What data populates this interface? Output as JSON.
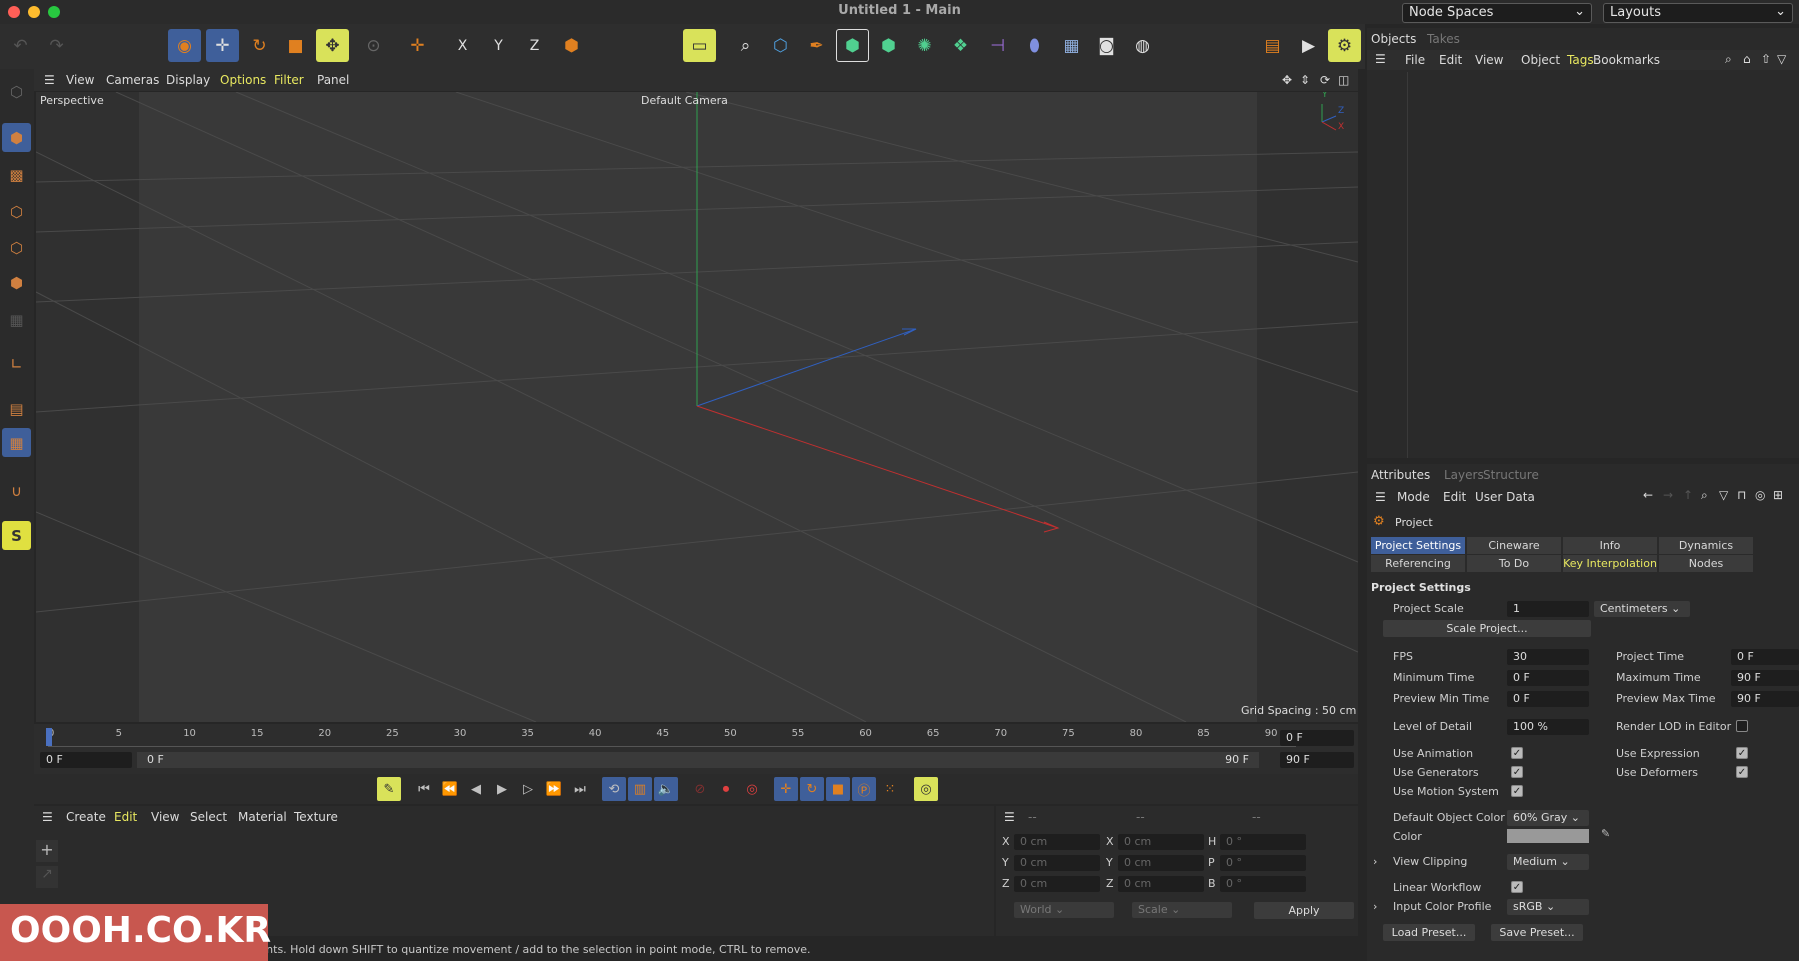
{
  "window": {
    "title": "Untitled 1 - Main",
    "node_spaces": "Node Spaces",
    "layouts": "Layouts"
  },
  "viewport_menu": [
    "View",
    "Cameras",
    "Display",
    "Options",
    "Filter",
    "Panel"
  ],
  "viewport": {
    "view_name": "Perspective",
    "camera": "Default Camera",
    "grid_spacing": "Grid Spacing : 50 cm",
    "axis_y": "Y",
    "axis_z": "Z",
    "axis_x": "X"
  },
  "timeline": {
    "ticks": [
      "0",
      "5",
      "10",
      "15",
      "20",
      "25",
      "30",
      "35",
      "40",
      "45",
      "50",
      "55",
      "60",
      "65",
      "70",
      "75",
      "80",
      "85",
      "90"
    ],
    "current_frame": "0 F",
    "start": "0 F",
    "range_start": "0 F",
    "range_end": "90 F",
    "end": "90 F"
  },
  "material_menu": [
    "Create",
    "Edit",
    "View",
    "Select",
    "Material",
    "Texture"
  ],
  "coord": {
    "header": [
      "--",
      "--",
      "--"
    ],
    "rows": [
      {
        "a": "X",
        "av": "0 cm",
        "b": "X",
        "bv": "0 cm",
        "c": "H",
        "cv": "0 °"
      },
      {
        "a": "Y",
        "av": "0 cm",
        "b": "Y",
        "bv": "0 cm",
        "c": "P",
        "cv": "0 °"
      },
      {
        "a": "Z",
        "av": "0 cm",
        "b": "Z",
        "bv": "0 cm",
        "c": "B",
        "cv": "0 °"
      }
    ],
    "world": "World",
    "scale": "Scale",
    "apply": "Apply"
  },
  "status": "Move: Click and drag to move elements. Hold down SHIFT to quantize movement / add to the selection in point mode, CTRL to remove.",
  "objects": {
    "tab1": "Objects",
    "tab2": "Takes",
    "menu": [
      "File",
      "Edit",
      "View",
      "Object",
      "Tags",
      "Bookmarks"
    ]
  },
  "attributes": {
    "tabs_top": [
      "Attributes",
      "Layers",
      "Structure"
    ],
    "menu": [
      "Mode",
      "Edit",
      "User Data"
    ],
    "object": "Project",
    "tabs": [
      "Project Settings",
      "Cineware",
      "Info",
      "Dynamics",
      "Referencing",
      "To Do",
      "Key Interpolation",
      "Nodes"
    ],
    "section": "Project Settings",
    "project_scale_label": "Project Scale",
    "project_scale": "1",
    "scale_unit": "Centimeters",
    "scale_project_btn": "Scale Project...",
    "fps_label": "FPS",
    "fps": "30",
    "project_time_label": "Project Time",
    "project_time": "0 F",
    "min_time_label": "Minimum Time",
    "min_time": "0 F",
    "max_time_label": "Maximum Time",
    "max_time": "90 F",
    "prev_min_label": "Preview Min Time",
    "prev_min": "0 F",
    "prev_max_label": "Preview Max Time",
    "prev_max": "90 F",
    "lod_label": "Level of Detail",
    "lod": "100 %",
    "render_lod_label": "Render LOD in Editor",
    "use_animation": "Use Animation",
    "use_expression": "Use Expression",
    "use_generators": "Use Generators",
    "use_deformers": "Use Deformers",
    "use_motion": "Use Motion System",
    "default_color_label": "Default Object Color",
    "default_color": "60% Gray",
    "color_label": "Color",
    "view_clipping_label": "View Clipping",
    "view_clipping": "Medium",
    "linear_workflow": "Linear Workflow",
    "input_color_label": "Input Color Profile",
    "input_color": "sRGB",
    "load_preset": "Load Preset...",
    "save_preset": "Save Preset..."
  },
  "watermark": "OOOH.CO.KR",
  "colors": {
    "accent": "#3f5f9a",
    "highlight": "#e8e860",
    "x_axis": "#c03030",
    "y_axis": "#30a050",
    "z_axis": "#3060c0"
  }
}
